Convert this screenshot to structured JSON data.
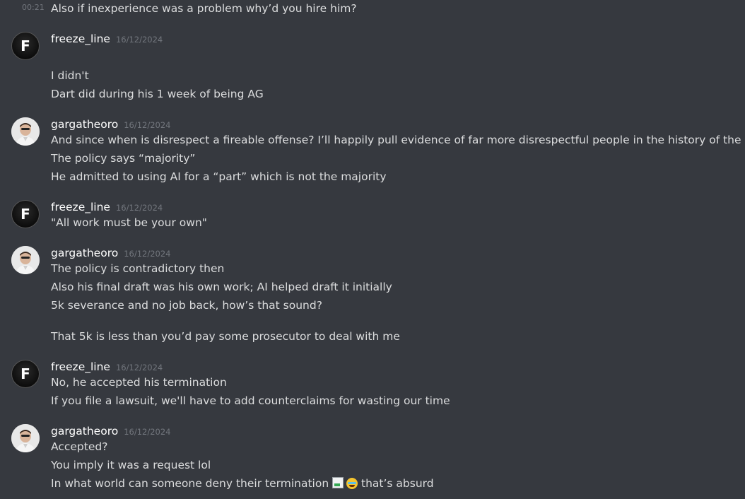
{
  "colors": {
    "background": "#36393f",
    "text": "#dcddde",
    "username": "#ffffff",
    "timestamp": "#72767d"
  },
  "continuation": {
    "time": "00:21",
    "text": "Also if inexperience was a problem why’d you hire him?"
  },
  "messages": [
    {
      "username": "freeze_line",
      "date": "16/12/2024",
      "avatar": "freeze-line-avatar",
      "avatar_letter": "F",
      "lines": [
        "I didn't",
        "Dart did during his 1 week of being AG"
      ]
    },
    {
      "username": "gargatheoro",
      "date": "16/12/2024",
      "avatar": "gargatheoro-avatar",
      "lines": [
        "And since when is disrespect a fireable offense? I’ll happily pull evidence of far more disrespectful people in the history of the DOJ",
        "The policy says “majority”",
        "He admitted to using AI for a “part” which is not the majority"
      ]
    },
    {
      "username": "freeze_line",
      "date": "16/12/2024",
      "avatar": "freeze-line-avatar",
      "avatar_letter": "F",
      "lines": [
        "\"All work must be your own\""
      ]
    },
    {
      "username": "gargatheoro",
      "date": "16/12/2024",
      "avatar": "gargatheoro-avatar",
      "lines": [
        "The policy is contradictory then",
        "Also his final draft was his own work; AI helped draft it initially",
        "5k severance and no job back, how’s that sound?",
        "That 5k is less than you’d pay some prosecutor to deal with me"
      ]
    },
    {
      "username": "freeze_line",
      "date": "16/12/2024",
      "avatar": "freeze-line-avatar",
      "avatar_letter": "F",
      "lines": [
        "No, he accepted his termination",
        "If you file a lawsuit, we'll have to add counterclaims for wasting our time"
      ]
    },
    {
      "username": "gargatheoro",
      "date": "16/12/2024",
      "avatar": "gargatheoro-avatar",
      "lines": [
        "Accepted?",
        "You imply it was a request lol",
        "In what world can someone deny their termination",
        "that’s absurd"
      ],
      "emojis": [
        "broken-image-icon",
        "grinning-squinting-emoji"
      ]
    }
  ]
}
